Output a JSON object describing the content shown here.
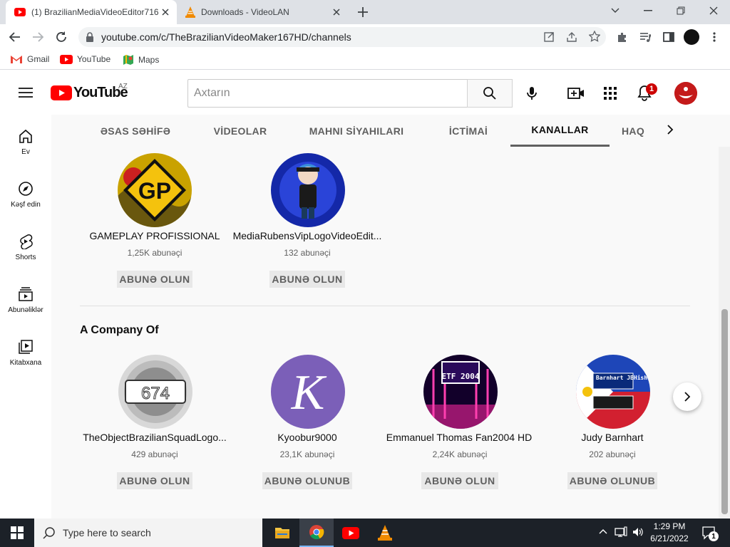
{
  "browser": {
    "tabs": [
      {
        "title": "(1) BrazilianMediaVideoEditor716",
        "active": true
      },
      {
        "title": "Downloads - VideoLAN",
        "active": false
      }
    ],
    "url": "youtube.com/c/TheBrazilianVideoMaker167HD/channels",
    "bookmarks": [
      "Gmail",
      "YouTube",
      "Maps"
    ]
  },
  "youtube": {
    "logo_text": "YouTube",
    "region": "AZ",
    "search_placeholder": "Axtarın",
    "notification_count": "1",
    "nav": [
      {
        "label": "Ev",
        "icon": "home-icon"
      },
      {
        "label": "Kəşf edin",
        "icon": "explore-icon"
      },
      {
        "label": "Shorts",
        "icon": "shorts-icon"
      },
      {
        "label": "Abunəliklər",
        "icon": "subscriptions-icon"
      },
      {
        "label": "Kitabxana",
        "icon": "library-icon"
      }
    ],
    "channel_tabs": [
      "ƏSAS SƏHİFƏ",
      "VİDEOLAR",
      "MAHNI SİYAHILARI",
      "İCTİMAİ",
      "KANALLAR",
      "HAQ"
    ],
    "selected_tab": "KANALLAR",
    "section1": {
      "channels": [
        {
          "name": "GAMEPLAY PROFISSIONAL",
          "subs": "1,25K abunəçi",
          "button": "ABUNƏ OLUN",
          "avatar_text": "GP"
        },
        {
          "name": "MediaRubensVipLogoVideoEdit...",
          "subs": "132 abunəçi",
          "button": "ABUNƏ OLUN"
        }
      ]
    },
    "section2": {
      "title": "A Company Of",
      "channels": [
        {
          "name": "TheObjectBrazilianSquadLogo...",
          "subs": "429 abunəçi",
          "button": "ABUNƏ OLUN",
          "avatar_text": "674"
        },
        {
          "name": "Kyoobur9000",
          "subs": "23,1K abunəçi",
          "button": "ABUNƏ OLUNUB",
          "avatar_text": "K"
        },
        {
          "name": "Emmanuel Thomas Fan2004 HD",
          "subs": "2,24K abunəçi",
          "button": "ABUNƏ OLUN",
          "avatar_text": "ETF 2004"
        },
        {
          "name": "Judy Barnhart",
          "subs": "202 abunəçi",
          "button": "ABUNƏ OLUNUB",
          "avatar_text": "Judy Barnhart JBHish"
        }
      ]
    }
  },
  "taskbar": {
    "search_placeholder": "Type here to search",
    "time": "1:29 PM",
    "date": "6/21/2022",
    "notifications": "1"
  },
  "colors": {
    "youtube_red": "#ff0000",
    "chrome_frame": "#dee1e6",
    "taskbar": "#1c2128"
  }
}
